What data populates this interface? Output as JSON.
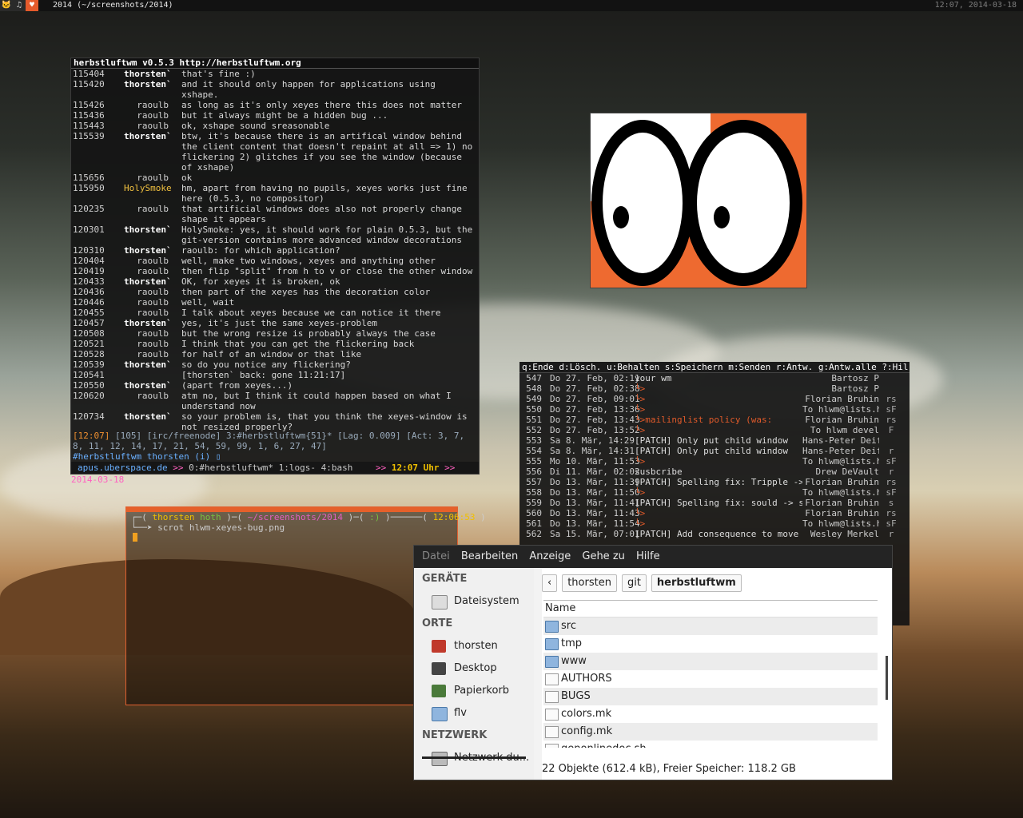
{
  "topbar": {
    "tags": [
      "🐱",
      "♫",
      "♥"
    ],
    "title": "2014 (~/screenshots/2014)",
    "clock": "12:07, 2014-03-18"
  },
  "irc": {
    "title": "herbstluftwm v0.5.3 http://herbstluftwm.org",
    "lines": [
      {
        "ts": "115404",
        "nick": "thorsten`",
        "cls": "n-th",
        "msg": "that's fine :)"
      },
      {
        "ts": "115420",
        "nick": "thorsten`",
        "cls": "n-th",
        "msg": "and it should only happen for applications using xshape."
      },
      {
        "ts": "115426",
        "nick": "raoulb",
        "cls": "n-ra",
        "msg": "as long as it's only xeyes there this does not matter"
      },
      {
        "ts": "115436",
        "nick": "raoulb",
        "cls": "n-ra",
        "msg": "but it always might be a hidden bug ..."
      },
      {
        "ts": "115443",
        "nick": "raoulb",
        "cls": "n-ra",
        "msg": "ok, xshape sound sreasonable"
      },
      {
        "ts": "115539",
        "nick": "thorsten`",
        "cls": "n-th",
        "msg": "btw, it's because there is an artifical window behind the client content that doesn't repaint at all => 1) no flickering 2) glitches if you see the window (because of xshape)"
      },
      {
        "ts": "115656",
        "nick": "raoulb",
        "cls": "n-ra",
        "msg": "ok"
      },
      {
        "ts": "115950",
        "nick": "HolySmoke",
        "cls": "n-hs",
        "msg": "hm, apart from having no pupils, xeyes works just fine here (0.5.3, no compositor)"
      },
      {
        "ts": "120235",
        "nick": "raoulb",
        "cls": "n-ra",
        "msg": "that artificial windows does also not properly change shape it appears"
      },
      {
        "ts": "120301",
        "nick": "thorsten`",
        "cls": "n-th",
        "msg": "HolySmoke: yes, it should work for plain 0.5.3, but the git-version contains more advanced window decorations"
      },
      {
        "ts": "120310",
        "nick": "thorsten`",
        "cls": "n-th",
        "msg": "raoulb: for which application?"
      },
      {
        "ts": "120404",
        "nick": "raoulb",
        "cls": "n-ra",
        "msg": "well, make two windows, xeyes and anything other"
      },
      {
        "ts": "120419",
        "nick": "raoulb",
        "cls": "n-ra",
        "msg": "then flip \"split\" from h to v or close the other window"
      },
      {
        "ts": "120433",
        "nick": "thorsten`",
        "cls": "n-th",
        "msg": "OK, for xeyes it is broken, ok"
      },
      {
        "ts": "120436",
        "nick": "raoulb",
        "cls": "n-ra",
        "msg": "then part of the xeyes has the decoration color"
      },
      {
        "ts": "120446",
        "nick": "raoulb",
        "cls": "n-ra",
        "msg": "well, wait"
      },
      {
        "ts": "120455",
        "nick": "raoulb",
        "cls": "n-ra",
        "msg": "I talk about xeyes because we can notice it there"
      },
      {
        "ts": "120457",
        "nick": "thorsten`",
        "cls": "n-th",
        "msg": "yes, it's just the same xeyes-problem"
      },
      {
        "ts": "120508",
        "nick": "raoulb",
        "cls": "n-ra",
        "msg": "but the wrong resize is probably always the case"
      },
      {
        "ts": "120521",
        "nick": "raoulb",
        "cls": "n-ra",
        "msg": "I think that you can get the flickering back"
      },
      {
        "ts": "120528",
        "nick": "raoulb",
        "cls": "n-ra",
        "msg": "for half of an window or that like"
      },
      {
        "ts": "120539",
        "nick": "thorsten`",
        "cls": "n-th",
        "msg": "so do you notice any flickering?"
      },
      {
        "ts": "120541",
        "nick": "",
        "cls": "n-th",
        "msg": "[thorsten` back: gone 11:21:17]"
      },
      {
        "ts": "120550",
        "nick": "thorsten`",
        "cls": "n-th",
        "msg": "(apart from xeyes...)"
      },
      {
        "ts": "120620",
        "nick": "raoulb",
        "cls": "n-ra",
        "msg": "atm no, but I think it could happen based on what I understand now"
      },
      {
        "ts": "120734",
        "nick": "thorsten`",
        "cls": "n-th",
        "msg": "so your problem is, that you think the xeyes-window is not resized properly?"
      }
    ],
    "status_time": "[12:07]",
    "status_rest": " [105] [irc/freenode] 3:#herbstluftwm{51}* [Lag: 0.009] [Act: 3, 7, 8, 11, 12, 14, 17, 21, 54, 59, 99, 1, 6, 27, 47]",
    "input": "#herbstluftwm thorsten (i) ▯",
    "tmux_host": "apus.uberspace.de",
    "tmux_windows": "0:#herbstluftwm* 1:logs- 4:bash",
    "tmux_time": "12:07 Uhr",
    "tmux_date": "2014-03-18"
  },
  "mutt": {
    "menu": "q:Ende  d:Lösch.  u:Behalten  s:Speichern  m:Senden  r:Antw.  g:Antw.alle  ?:Hil",
    "rows": [
      {
        "num": "547",
        "date": "Do 27. Feb, 02:11",
        "subj": "your wm",
        "arrow": false,
        "from": "Bartosz P",
        "flag": ""
      },
      {
        "num": "548",
        "date": "Do 27. Feb, 02:38",
        "subj": "└>",
        "arrow": true,
        "from": "Bartosz P",
        "flag": ""
      },
      {
        "num": "549",
        "date": "Do 27. Feb, 09:01",
        "subj": "└>",
        "arrow": true,
        "from": "Florian Bruhin",
        "flag": "rs"
      },
      {
        "num": "550",
        "date": "Do 27. Feb, 13:36",
        "subj": "  └>",
        "arrow": true,
        "from": "To hlwm@lists.herbstluftwm.org",
        "flag": "sF"
      },
      {
        "num": "551",
        "date": "Do 27. Feb, 13:43",
        "subj": "    └>mailinglist policy (was:",
        "arrow": true,
        "from": "Florian Bruhin",
        "flag": "rs"
      },
      {
        "num": "552",
        "date": "Do 27. Feb, 13:52",
        "subj": "      └>",
        "arrow": true,
        "from": "To hlwm devel",
        "flag": "F"
      },
      {
        "num": "553",
        "date": "Sa  8. Mär, 14:29",
        "subj": "[PATCH] Only put child window",
        "arrow": false,
        "from": "Hans-Peter Deifel",
        "flag": ""
      },
      {
        "num": "554",
        "date": "Sa  8. Mär, 14:31",
        "subj": "[PATCH] Only put child window",
        "arrow": false,
        "from": "Hans-Peter Deifel",
        "flag": "r"
      },
      {
        "num": "555",
        "date": "Mo 10. Mär, 11:53",
        "subj": "└>",
        "arrow": true,
        "from": "To hlwm@lists.herbstluftwm.org",
        "flag": "sF"
      },
      {
        "num": "556",
        "date": "Di 11. Mär, 02:02",
        "subj": "susbcribe",
        "arrow": false,
        "from": "Drew DeVault",
        "flag": "r"
      },
      {
        "num": "557",
        "date": "Do 13. Mär, 11:39",
        "subj": "[PATCH] Spelling fix: Tripple ->",
        "arrow": false,
        "from": "Florian Bruhin",
        "flag": "rs"
      },
      {
        "num": "558",
        "date": "Do 13. Mär, 11:50",
        "subj": "└>",
        "arrow": true,
        "from": "To hlwm@lists.herbstluftwm.org",
        "flag": "sF"
      },
      {
        "num": "559",
        "date": "Do 13. Mär, 11:41",
        "subj": "[PATCH] Spelling fix: sould -> s",
        "arrow": false,
        "from": "Florian Bruhin",
        "flag": "s"
      },
      {
        "num": "560",
        "date": "Do 13. Mär, 11:43",
        "subj": "└>",
        "arrow": true,
        "from": "Florian Bruhin",
        "flag": "rs"
      },
      {
        "num": "561",
        "date": "Do 13. Mär, 11:54",
        "subj": "└>",
        "arrow": true,
        "from": "To hlwm@lists.herbstluftwm.org",
        "flag": "sF"
      },
      {
        "num": "562",
        "date": "Sa 15. Mär, 07:01",
        "subj": "[PATCH] Add consequence to move a",
        "arrow": false,
        "from": "Wesley Merkel",
        "flag": "r"
      }
    ]
  },
  "shell": {
    "line1_user": "thorsten",
    "line1_host": "hoth",
    "line1_path": "~/screenshots/2014",
    "line1_mood": ":)",
    "line1_time": "12:06:53",
    "line2_cmd": "scrot hlwm-xeyes-bug.png"
  },
  "filemanager": {
    "menu": [
      "Datei",
      "Bearbeiten",
      "Anzeige",
      "Gehe zu",
      "Hilfe"
    ],
    "sections": {
      "devices": "GERÄTE",
      "places": "ORTE",
      "network": "NETZWERK"
    },
    "device_items": [
      "Dateisystem"
    ],
    "place_items": [
      "thorsten",
      "Desktop",
      "Papierkorb",
      "flv"
    ],
    "network_items": [
      "Netzwerk du..."
    ],
    "path": [
      "thorsten",
      "git",
      "herbstluftwm"
    ],
    "column_name": "Name",
    "files": [
      {
        "name": "src",
        "type": "folder"
      },
      {
        "name": "tmp",
        "type": "folder"
      },
      {
        "name": "www",
        "type": "folder"
      },
      {
        "name": "AUTHORS",
        "type": "file"
      },
      {
        "name": "BUGS",
        "type": "file"
      },
      {
        "name": "colors.mk",
        "type": "file"
      },
      {
        "name": "config.mk",
        "type": "file"
      },
      {
        "name": "genonlinedoc.sh",
        "type": "file"
      }
    ],
    "status": "22 Objekte (612.4 kB), Freier Speicher: 118.2 GB"
  }
}
